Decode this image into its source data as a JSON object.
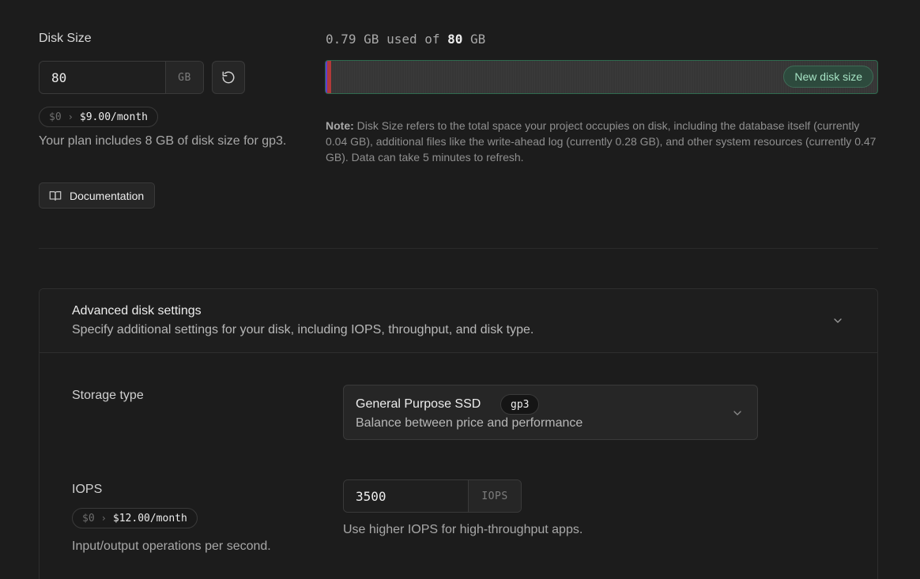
{
  "disk": {
    "label": "Disk Size",
    "value": "80",
    "unit": "GB",
    "price_old": "$0",
    "price_new": "$9.00/month",
    "plan_note": "Your plan includes 8 GB of disk size for gp3.",
    "doc_label": "Documentation"
  },
  "usage": {
    "used_text": "0.79 GB used of",
    "total_text": "80",
    "total_unit": "GB",
    "used_gb": 0.79,
    "total_gb": 80,
    "new_size_label": "New disk size",
    "note_title": "Note:",
    "note_body": "Disk Size refers to the total space your project occupies on disk, including the database itself (currently 0.04 GB), additional files like the write-ahead log (currently 0.28 GB), and other system resources (currently 0.47 GB). Data can take 5 minutes to refresh.",
    "colors": {
      "bar_border": "#2f6b4f",
      "fill_accent": "#5b3fd0",
      "fill_used": "#b03a3a"
    }
  },
  "advanced": {
    "title": "Advanced disk settings",
    "description": "Specify additional settings for your disk, including IOPS, throughput, and disk type.",
    "storage": {
      "label": "Storage type",
      "selected_name": "General Purpose SSD",
      "selected_badge": "gp3",
      "selected_desc": "Balance between price and performance"
    },
    "iops": {
      "label": "IOPS",
      "price_old": "$0",
      "price_new": "$12.00/month",
      "description": "Input/output operations per second.",
      "value": "3500",
      "unit": "IOPS",
      "help": "Use higher IOPS for high-throughput apps."
    }
  },
  "icons": {
    "reset": "reset-icon",
    "book": "book-icon",
    "chevron": "chevron-down-icon",
    "price_arrow": "chevron-right-icon"
  }
}
